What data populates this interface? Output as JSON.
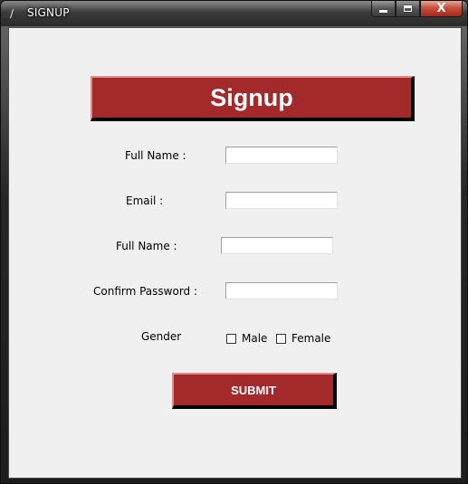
{
  "window": {
    "title": "SIGNUP",
    "icon": "feather-icon",
    "close_glyph": "X"
  },
  "form": {
    "heading": "Signup",
    "fields": [
      {
        "label": "Full Name :",
        "value": ""
      },
      {
        "label": "Email :",
        "value": ""
      },
      {
        "label": "Full Name :",
        "value": ""
      },
      {
        "label": "Confirm Password :",
        "value": ""
      }
    ],
    "gender": {
      "label": "Gender",
      "options": [
        {
          "label": "Male",
          "checked": false
        },
        {
          "label": "Female",
          "checked": false
        }
      ]
    },
    "submit_label": "SUBMIT"
  },
  "colors": {
    "accent": "#a4292b",
    "accent_highlight": "#e38b88",
    "background": "#f0f0f0"
  }
}
